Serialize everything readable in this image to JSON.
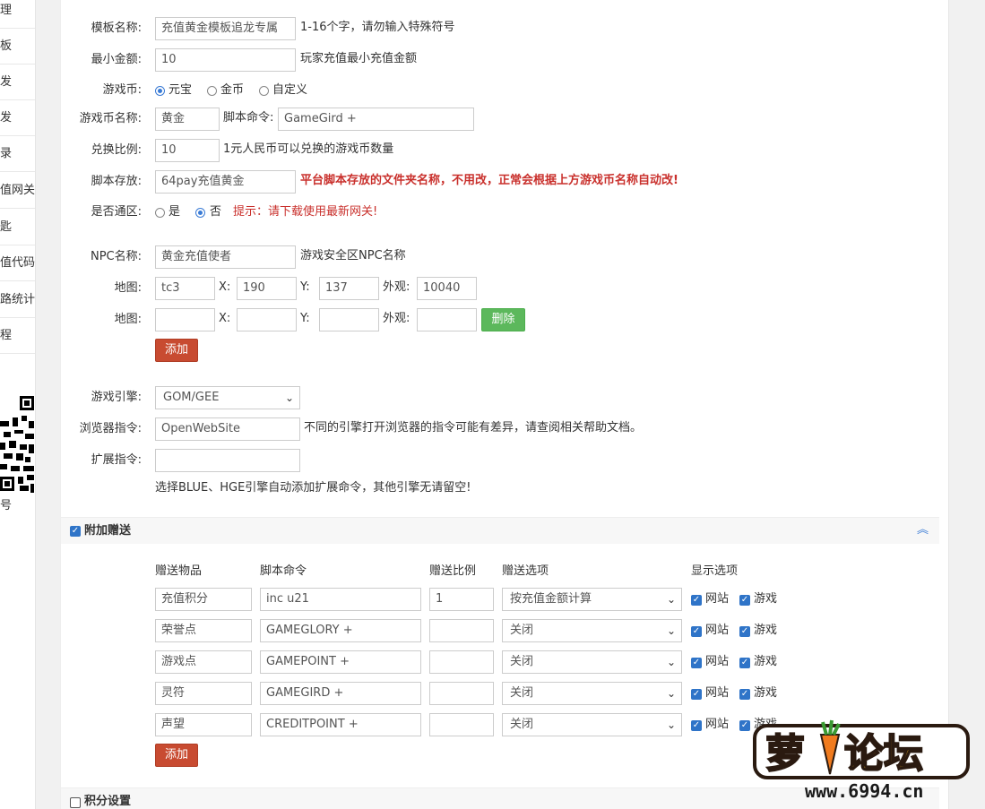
{
  "sidebar": {
    "items": [
      "理",
      "板",
      "发",
      "发",
      "录",
      "值网关",
      "匙",
      "值代码",
      "路统计",
      "程"
    ],
    "footer": "号"
  },
  "form": {
    "template_name": {
      "label": "模板名称:",
      "value": "充值黄金模板追龙专属",
      "note": "1-16个字，请勿输入特殊符号"
    },
    "min_amount": {
      "label": "最小金额:",
      "value": "10",
      "note": "玩家充值最小充值金额"
    },
    "currency": {
      "label": "游戏币:",
      "options": [
        "元宝",
        "金币",
        "自定义"
      ],
      "selected": 0
    },
    "currency_name": {
      "label": "游戏币名称:",
      "value": "黄金",
      "cmd_label": "脚本命令:",
      "cmd_value": "GameGird +"
    },
    "ratio": {
      "label": "兑换比例:",
      "value": "10",
      "note": "1元人民币可以兑换的游戏币数量"
    },
    "script_dir": {
      "label": "脚本存放:",
      "value": "64pay充值黄金",
      "note": "平台脚本存放的文件夹名称，不用改，正常会根据上方游戏币名称自动改!"
    },
    "all_zone": {
      "label": "是否通区:",
      "options": [
        "是",
        "否"
      ],
      "selected": 1,
      "hint": "提示：请下载使用最新网关!"
    },
    "npc": {
      "label": "NPC名称:",
      "value": "黄金充值使者",
      "note": "游戏安全区NPC名称"
    },
    "maps": {
      "label": "地图:",
      "x_label": "X:",
      "y_label": "Y:",
      "look_label": "外观:",
      "rows": [
        {
          "map": "tc3",
          "x": "190",
          "y": "137",
          "look": "10040"
        },
        {
          "map": "",
          "x": "",
          "y": "",
          "look": ""
        }
      ],
      "delete_label": "删除",
      "add_label": "添加"
    },
    "engine": {
      "label": "游戏引擎:",
      "value": "GOM/GEE"
    },
    "browser_cmd": {
      "label": "浏览器指令:",
      "value": "OpenWebSite",
      "note": "不同的引擎打开浏览器的指令可能有差异，请查阅相关帮助文档。"
    },
    "ext_cmd": {
      "label": "扩展指令:",
      "value": "",
      "note": "选择BLUE、HGE引擎自动添加扩展命令，其他引擎无请留空!"
    }
  },
  "bonus": {
    "title": "附加赠送",
    "checked": true,
    "columns": [
      "赠送物品",
      "脚本命令",
      "赠送比例",
      "赠送选项",
      "显示选项"
    ],
    "rows": [
      {
        "item": "充值积分",
        "cmd": "inc u21",
        "ratio": "1",
        "option": "按充值金额计算"
      },
      {
        "item": "荣誉点",
        "cmd": "GAMEGLORY +",
        "ratio": "",
        "option": "关闭"
      },
      {
        "item": "游戏点",
        "cmd": "GAMEPOINT +",
        "ratio": "",
        "option": "关闭"
      },
      {
        "item": "灵符",
        "cmd": "GAMEGIRD +",
        "ratio": "",
        "option": "关闭"
      },
      {
        "item": "声望",
        "cmd": "CREDITPOINT +",
        "ratio": "",
        "option": "关闭"
      }
    ],
    "show_site": "网站",
    "show_game": "游戏",
    "add_label": "添加"
  },
  "points": {
    "title": "积分设置",
    "checked": false
  },
  "watermark": {
    "text": "萝卜论坛",
    "url": "www.6994.cn"
  },
  "colors": {
    "accent": "#2f74c8",
    "danger": "#c84b31",
    "success": "#5cb85c",
    "warn": "#c9302c"
  }
}
